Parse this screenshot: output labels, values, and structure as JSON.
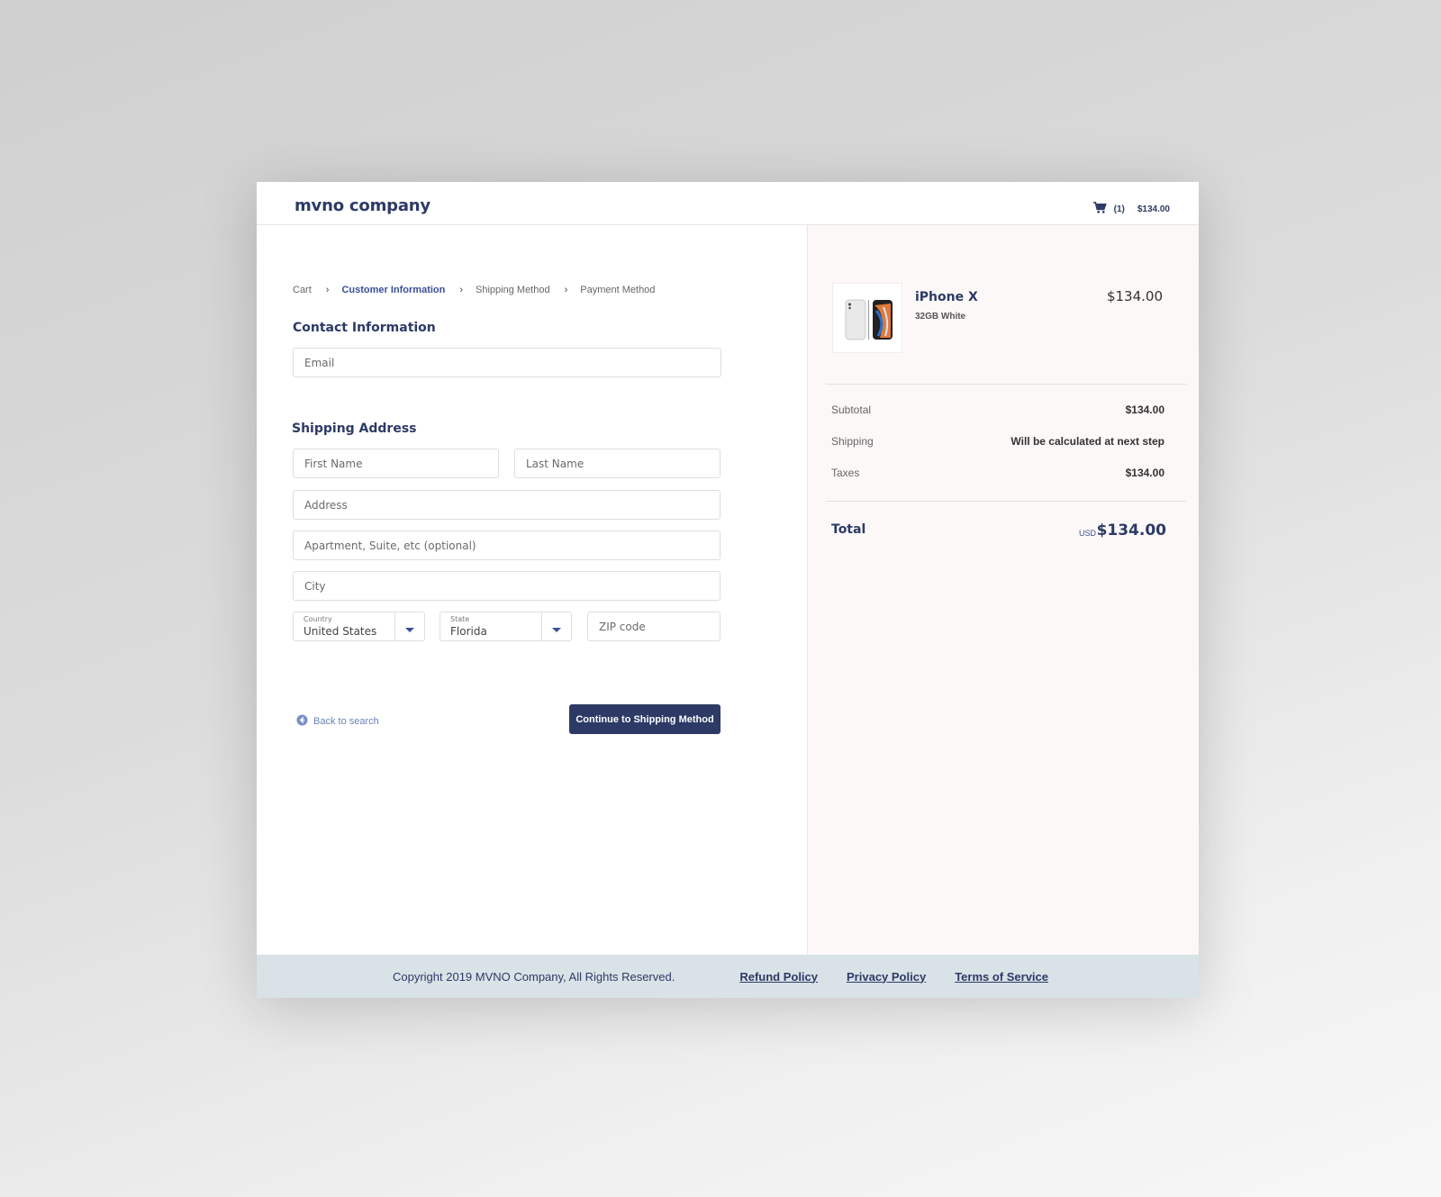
{
  "header": {
    "logo": "mvno company",
    "cart_count": "(1)",
    "cart_total": "$134.00"
  },
  "breadcrumb": [
    {
      "label": "Cart",
      "active": false
    },
    {
      "label": "Customer Information",
      "active": true
    },
    {
      "label": "Shipping Method",
      "active": false
    },
    {
      "label": "Payment Method",
      "active": false
    }
  ],
  "breadcrumb_separator": "›",
  "contact": {
    "title": "Contact Information",
    "email_placeholder": "Email"
  },
  "shipping": {
    "title": "Shipping Address",
    "first_name_placeholder": "First Name",
    "last_name_placeholder": "Last Name",
    "address_placeholder": "Address",
    "apartment_placeholder": "Apartment, Suite, etc (optional)",
    "city_placeholder": "City",
    "country_label": "Country",
    "country_value": "United States",
    "state_label": "State",
    "state_value": "Florida",
    "zip_placeholder": "ZIP code"
  },
  "actions": {
    "back_label": "Back to search",
    "continue_label": "Continue to Shipping Method"
  },
  "summary": {
    "product_name": "iPhone X",
    "product_variant": "32GB White",
    "product_price": "$134.00",
    "subtotal_label": "Subtotal",
    "subtotal_value": "$134.00",
    "shipping_label": "Shipping",
    "shipping_value": "Will be calculated at next step",
    "taxes_label": "Taxes",
    "taxes_value": "$134.00",
    "total_label": "Total",
    "total_currency": "USD",
    "total_value": "$134.00"
  },
  "footer": {
    "copyright": "Copyright 2019 MVNO Company, All Rights Reserved.",
    "links": [
      "Refund Policy",
      "Privacy Policy",
      "Terms of Service"
    ]
  },
  "colors": {
    "primary": "#2d3a66",
    "accent": "#3a4f9a",
    "summary_bg": "#fbf8f7",
    "footer_bg": "#d9e2e7"
  },
  "icons": [
    "cart-icon",
    "chevron-down-icon",
    "arrow-left-circle-icon",
    "product-image"
  ]
}
